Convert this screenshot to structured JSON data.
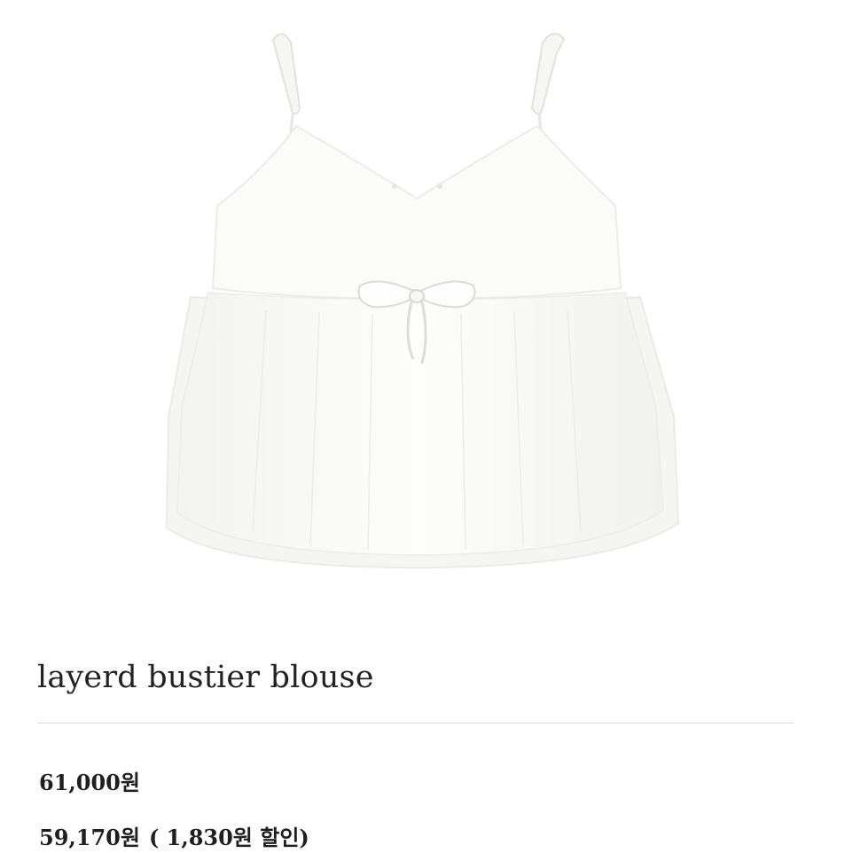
{
  "product": {
    "image_alt": "white layered bustier blouse",
    "title": "layerd bustier blouse",
    "original_price": "61,000원",
    "sale_price": "59,170원",
    "discount_note": "( 1,830원 할인)"
  }
}
